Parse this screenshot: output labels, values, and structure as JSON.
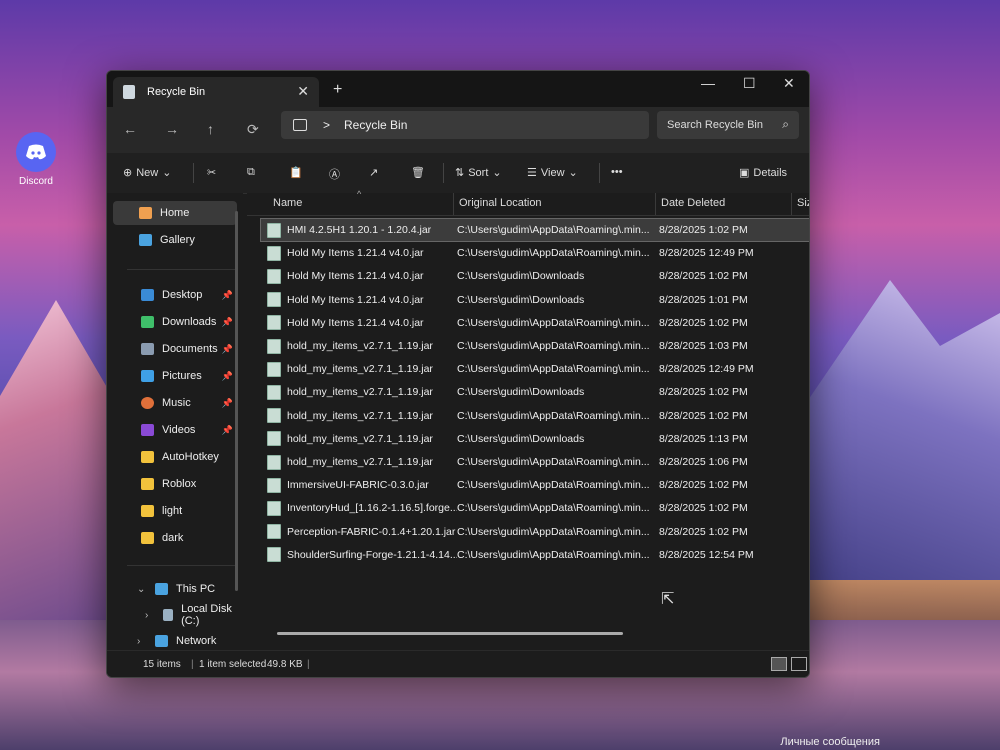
{
  "desktop": {
    "discord_label": "Discord",
    "corner_text": "Личные сообщения"
  },
  "window": {
    "tab_title": "Recycle Bin",
    "new_tab": "+",
    "controls": {
      "minimize": "—",
      "maximize": "☐",
      "close": "✕"
    }
  },
  "navbar": {
    "back": "←",
    "forward": "→",
    "up": "↑",
    "refresh": "⟳",
    "address_separator": ">",
    "address_location": "Recycle Bin",
    "search_placeholder": "Search Recycle Bin"
  },
  "toolbar": {
    "new_label": "New",
    "sort_label": "Sort",
    "view_label": "View",
    "more_label": "•••",
    "details_label": "Details"
  },
  "sidebar": {
    "home": "Home",
    "gallery": "Gallery",
    "desktop": "Desktop",
    "downloads": "Downloads",
    "documents": "Documents",
    "pictures": "Pictures",
    "music": "Music",
    "videos": "Videos",
    "autohotkey": "AutoHotkey",
    "roblox": "Roblox",
    "light": "light",
    "dark": "dark",
    "this_pc": "This PC",
    "local_disk": "Local Disk (C:)",
    "network": "Network"
  },
  "columns": {
    "name": "Name",
    "location": "Original Location",
    "date": "Date Deleted",
    "size": "Size"
  },
  "files": [
    {
      "name": "HMI 4.2.5H1 1.20.1 - 1.20.4.jar",
      "location": "C:\\Users\\gudim\\AppData\\Roaming\\.min...",
      "date": "8/28/2025 1:02 PM"
    },
    {
      "name": "Hold My Items 1.21.4 v4.0.jar",
      "location": "C:\\Users\\gudim\\AppData\\Roaming\\.min...",
      "date": "8/28/2025 12:49 PM"
    },
    {
      "name": "Hold My Items 1.21.4 v4.0.jar",
      "location": "C:\\Users\\gudim\\Downloads",
      "date": "8/28/2025 1:02 PM"
    },
    {
      "name": "Hold My Items 1.21.4 v4.0.jar",
      "location": "C:\\Users\\gudim\\Downloads",
      "date": "8/28/2025 1:01 PM"
    },
    {
      "name": "Hold My Items 1.21.4 v4.0.jar",
      "location": "C:\\Users\\gudim\\AppData\\Roaming\\.min...",
      "date": "8/28/2025 1:02 PM"
    },
    {
      "name": "hold_my_items_v2.7.1_1.19.jar",
      "location": "C:\\Users\\gudim\\AppData\\Roaming\\.min...",
      "date": "8/28/2025 1:03 PM"
    },
    {
      "name": "hold_my_items_v2.7.1_1.19.jar",
      "location": "C:\\Users\\gudim\\AppData\\Roaming\\.min...",
      "date": "8/28/2025 12:49 PM"
    },
    {
      "name": "hold_my_items_v2.7.1_1.19.jar",
      "location": "C:\\Users\\gudim\\Downloads",
      "date": "8/28/2025 1:02 PM"
    },
    {
      "name": "hold_my_items_v2.7.1_1.19.jar",
      "location": "C:\\Users\\gudim\\AppData\\Roaming\\.min...",
      "date": "8/28/2025 1:02 PM"
    },
    {
      "name": "hold_my_items_v2.7.1_1.19.jar",
      "location": "C:\\Users\\gudim\\Downloads",
      "date": "8/28/2025 1:13 PM"
    },
    {
      "name": "hold_my_items_v2.7.1_1.19.jar",
      "location": "C:\\Users\\gudim\\AppData\\Roaming\\.min...",
      "date": "8/28/2025 1:06 PM"
    },
    {
      "name": "ImmersiveUI-FABRIC-0.3.0.jar",
      "location": "C:\\Users\\gudim\\AppData\\Roaming\\.min...",
      "date": "8/28/2025 1:02 PM"
    },
    {
      "name": "InventoryHud_[1.16.2-1.16.5].forge...",
      "location": "C:\\Users\\gudim\\AppData\\Roaming\\.min...",
      "date": "8/28/2025 1:02 PM"
    },
    {
      "name": "Perception-FABRIC-0.1.4+1.20.1.jar",
      "location": "C:\\Users\\gudim\\AppData\\Roaming\\.min...",
      "date": "8/28/2025 1:02 PM"
    },
    {
      "name": "ShoulderSurfing-Forge-1.21.1-4.14...",
      "location": "C:\\Users\\gudim\\AppData\\Roaming\\.min...",
      "date": "8/28/2025 12:54 PM"
    }
  ],
  "status": {
    "count": "15 items",
    "selected": "1 item selected",
    "size": "49.8 KB"
  }
}
